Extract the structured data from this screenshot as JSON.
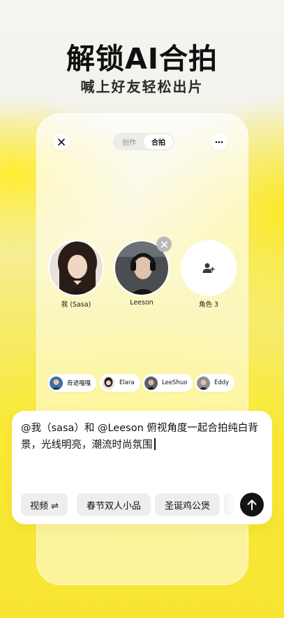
{
  "promo": {
    "headline": "解锁AI合拍",
    "subheadline": "喊上好友轻松出片"
  },
  "topbar": {
    "close_icon": "close-icon",
    "more_icon": "more-horizontal-icon",
    "tabs": [
      {
        "label": "创作",
        "active": false
      },
      {
        "label": "合拍",
        "active": true
      }
    ]
  },
  "participants": [
    {
      "label": "我 (Sasa)",
      "type": "photo"
    },
    {
      "label": "Leeson",
      "type": "photo",
      "removable": true
    },
    {
      "label": "角色 3",
      "type": "add",
      "icon": "add-person-icon"
    }
  ],
  "friends": [
    {
      "name": "奇迹嘎嘎"
    },
    {
      "name": "Elara"
    },
    {
      "name": "LeeShuo"
    },
    {
      "name": "Eddy"
    }
  ],
  "composer": {
    "prompt": "@我（sasa）和 @Leeson 俯视角度一起合拍纯白背景，光线明亮，潮流时尚氛围",
    "mode_label": "视频 ⇌",
    "suggestions": [
      "春节双人小品",
      "圣诞鸡公煲"
    ],
    "send_icon": "arrow-up-icon"
  },
  "colors": {
    "accent_yellow": "#f8e838",
    "send_button": "#141414",
    "chip_bg": "#ffffff"
  }
}
